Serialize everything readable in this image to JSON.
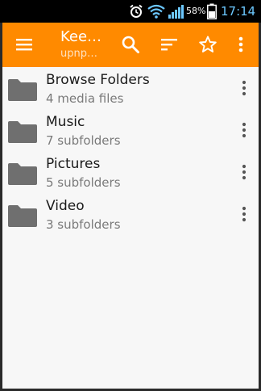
{
  "status_bar": {
    "battery_percent": "58%",
    "time": "17:14",
    "icons": [
      "alarm-icon",
      "wifi-icon",
      "signal-icon",
      "battery-icon"
    ]
  },
  "app_bar": {
    "title": "Kee…",
    "subtitle": "upnp…",
    "icons": [
      "menu-icon",
      "search-icon",
      "sort-icon",
      "star-icon",
      "more-vert-icon"
    ],
    "accent_color": "#ff8a00"
  },
  "items": [
    {
      "title": "Browse Folders",
      "subtitle": "4 media files",
      "icon": "folder-icon"
    },
    {
      "title": "Music",
      "subtitle": "7 subfolders",
      "icon": "folder-icon"
    },
    {
      "title": "Pictures",
      "subtitle": "5 subfolders",
      "icon": "folder-icon"
    },
    {
      "title": "Video",
      "subtitle": "3 subfolders",
      "icon": "folder-icon"
    }
  ]
}
